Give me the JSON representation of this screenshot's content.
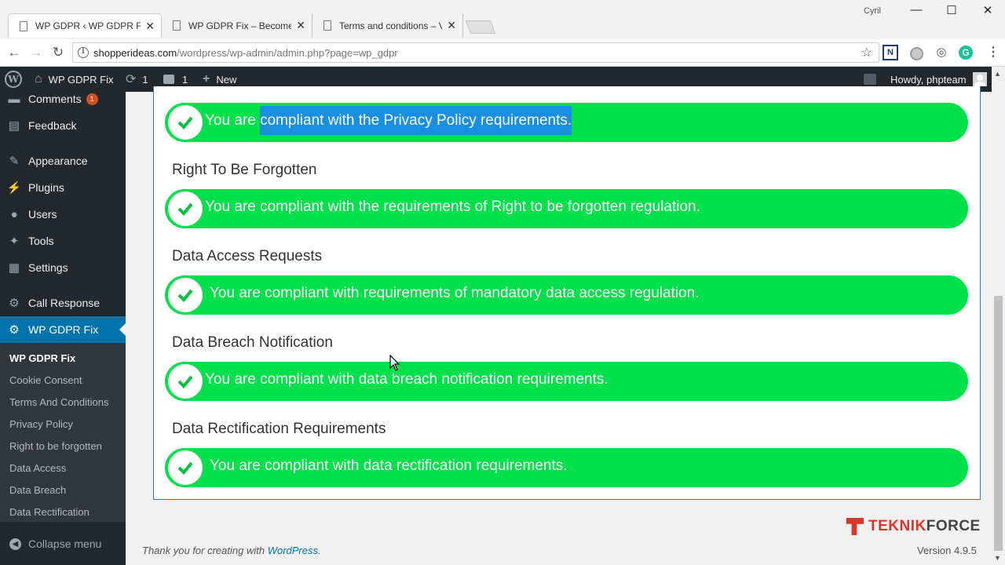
{
  "browser": {
    "tabs": [
      {
        "label": "WP GDPR ‹ WP GDPR Fix",
        "close": "✕"
      },
      {
        "label": "WP GDPR Fix – Become C",
        "close": "✕"
      },
      {
        "label": "Terms and conditions – V",
        "close": "✕"
      }
    ],
    "window_user": "Cyril",
    "window_controls": {
      "minimize": "—",
      "maximize": "☐",
      "close": "✕"
    },
    "url_host": "shopperideas.com",
    "url_path": "/wordpress/wp-admin/admin.php?page=wp_gdpr",
    "icons": {
      "back": "back-arrow-icon",
      "forward": "forward-arrow-icon",
      "reload": "reload-icon",
      "bookmark": "star-icon"
    },
    "extensions": {
      "n": "N",
      "grammarly": "G"
    }
  },
  "adminbar": {
    "site_name": "WP GDPR Fix",
    "updates_count": "1",
    "comments_count": "1",
    "new_label": "New",
    "howdy": "Howdy, phpteam"
  },
  "sidebar": {
    "items": [
      {
        "label": "Comments",
        "badge": "1",
        "icon": "comments-icon"
      },
      {
        "label": "Feedback",
        "icon": "feedback-icon"
      },
      {
        "label": "Appearance",
        "icon": "appearance-icon"
      },
      {
        "label": "Plugins",
        "icon": "plugins-icon"
      },
      {
        "label": "Users",
        "icon": "users-icon"
      },
      {
        "label": "Tools",
        "icon": "tools-icon"
      },
      {
        "label": "Settings",
        "icon": "settings-icon"
      },
      {
        "label": "Call Response",
        "icon": "gear-icon"
      },
      {
        "label": "WP GDPR Fix",
        "icon": "gear-icon"
      }
    ],
    "submenu": [
      "WP GDPR Fix",
      "Cookie Consent",
      "Terms And Conditions",
      "Privacy Policy",
      "Right to be forgotten",
      "Data Access",
      "Data Breach",
      "Data Rectification"
    ],
    "collapse": "Collapse menu"
  },
  "content": {
    "privacy": {
      "prefix": "You are ",
      "highlighted": "compliant with the Privacy Policy requirements."
    },
    "sections": [
      {
        "title": "Right To Be Forgotten",
        "message": "You are compliant with the requirements of Right to be forgotten regulation."
      },
      {
        "title": "Data Access Requests",
        "message": "You are compliant with requirements of mandatory data access regulation."
      },
      {
        "title": "Data Breach Notification",
        "message": "You are compliant with data breach notification requirements."
      },
      {
        "title": "Data Rectification Requirements",
        "message": "You are compliant with data rectification requirements."
      }
    ],
    "status_color": "#00e04b"
  },
  "footer": {
    "thanks_prefix": "Thank you for creating with ",
    "thanks_link": "WordPress",
    "thanks_suffix": ".",
    "version": "Version 4.9.5",
    "logo_part1": "TEKNIK",
    "logo_part2": "FORCE"
  }
}
